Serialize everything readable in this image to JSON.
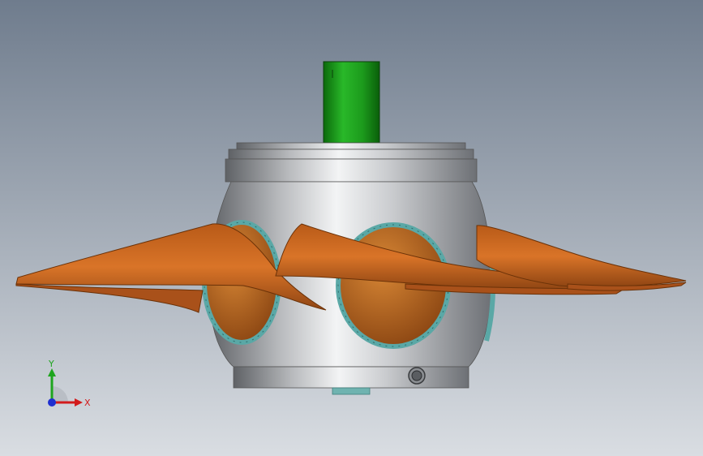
{
  "viewport": {
    "background_top": "#6f7c8d",
    "background_bottom": "#d9dde2"
  },
  "model": {
    "shaft_color": "#1f9a1f",
    "hub_color": "#a3a6aa",
    "blade_color": "#c7641a",
    "flange_color": "#5aa8a6"
  },
  "triad": {
    "x_label": "X",
    "y_label": "Y",
    "x_color": "#d21b1b",
    "y_color": "#1ea51e",
    "z_color": "#1f2fd0"
  }
}
